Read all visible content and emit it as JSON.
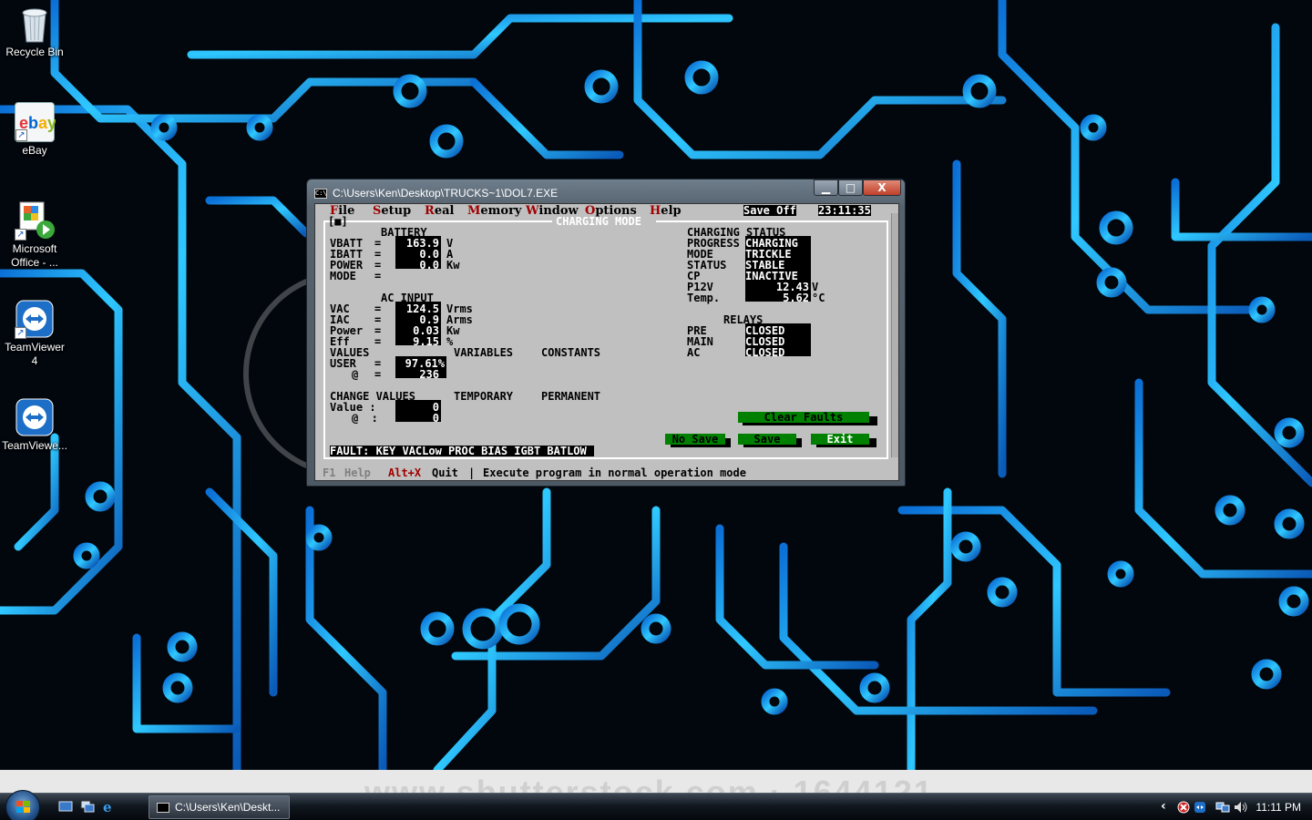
{
  "desktop": {
    "icons": [
      {
        "label": "Recycle Bin"
      },
      {
        "label": "eBay"
      },
      {
        "label": "Microsoft Office - ..."
      },
      {
        "label": "TeamViewer 4"
      },
      {
        "label": "TeamViewe..."
      }
    ],
    "watermark": "www.shutterstock.com · 1644121"
  },
  "window": {
    "title": "C:\\Users\\Ken\\Desktop\\TRUCKS~1\\DOL7.EXE",
    "controls": {
      "minimize": "▁",
      "maximize": "□",
      "close": "X"
    }
  },
  "app": {
    "menu": [
      {
        "hotkey": "F",
        "rest": "ile"
      },
      {
        "hotkey": "S",
        "rest": "etup"
      },
      {
        "hotkey": "R",
        "rest": "eal"
      },
      {
        "hotkey": "M",
        "rest": "emory"
      },
      {
        "hotkey": "W",
        "rest": "indow"
      },
      {
        "hotkey": "O",
        "rest": "ptions"
      },
      {
        "hotkey": "H",
        "rest": "elp"
      }
    ],
    "save_status": "Save Off",
    "clock": "23:11:35",
    "frame_marker": "[■]",
    "panel_title": "CHARGING MODE",
    "battery": {
      "header": "BATTERY",
      "rows": [
        {
          "label": "VBATT",
          "eq": "=",
          "value": "163.9",
          "unit": "V"
        },
        {
          "label": "IBATT",
          "eq": "=",
          "value": "0.0",
          "unit": "A"
        },
        {
          "label": "POWER",
          "eq": "=",
          "value": "0.0",
          "unit": "Kw"
        },
        {
          "label": "MODE",
          "eq": "=",
          "value": "",
          "unit": ""
        }
      ]
    },
    "ac_input": {
      "header": "AC INPUT",
      "rows": [
        {
          "label": "VAC",
          "eq": "=",
          "value": "124.5",
          "unit": "Vrms"
        },
        {
          "label": "IAC",
          "eq": "=",
          "value": "0.9",
          "unit": "Arms"
        },
        {
          "label": "Power",
          "eq": "=",
          "value": "0.03",
          "unit": "Kw"
        },
        {
          "label": "Eff",
          "eq": "=",
          "value": "9.15",
          "unit": "%"
        }
      ]
    },
    "values_header": {
      "values": "VALUES",
      "variables": "VARIABLES",
      "constants": "CONSTANTS"
    },
    "user": {
      "label": "USER",
      "eq": "=",
      "value": "97.61%",
      "at_label": "@",
      "at_eq": "=",
      "at_value": "236"
    },
    "change_values": {
      "header": "CHANGE VALUES",
      "temporary": "TEMPORARY",
      "permanent": "PERMANENT",
      "value_label": "Value :",
      "value": "0",
      "at_label": "@  :",
      "at_value": "0"
    },
    "charging_status": {
      "header": "CHARGING STATUS",
      "rows": [
        {
          "label": "PROGRESS",
          "value": "CHARGING"
        },
        {
          "label": "MODE",
          "value": "TRICKLE"
        },
        {
          "label": "STATUS",
          "value": "STABLE"
        },
        {
          "label": "CP",
          "value": "INACTIVE"
        },
        {
          "label": "P12V",
          "value": "12.43",
          "unit": "V"
        },
        {
          "label": "Temp.",
          "value": "5.62",
          "unit": "°C"
        }
      ]
    },
    "relays": {
      "header": "RELAYS",
      "rows": [
        {
          "label": "PRE",
          "value": "CLOSED"
        },
        {
          "label": "MAIN",
          "value": "CLOSED"
        },
        {
          "label": "AC",
          "value": "CLOSED"
        }
      ]
    },
    "buttons": {
      "clear_faults": "Clear Faults",
      "no_save": "No Save",
      "save": "Save",
      "exit": "Exit"
    },
    "fault_line": "FAULT: KEY VACLow PROC BIAS IGBT BATLOW",
    "status_bar": {
      "f1": "F1",
      "help": "Help",
      "alt_x": "Alt+X",
      "quit": "Quit",
      "sep": "|",
      "message": "Execute program in normal operation mode"
    }
  },
  "taskbar": {
    "task_button": "C:\\Users\\Ken\\Deskt...",
    "clock": "11:11 PM",
    "tray_arrow": "‹"
  }
}
